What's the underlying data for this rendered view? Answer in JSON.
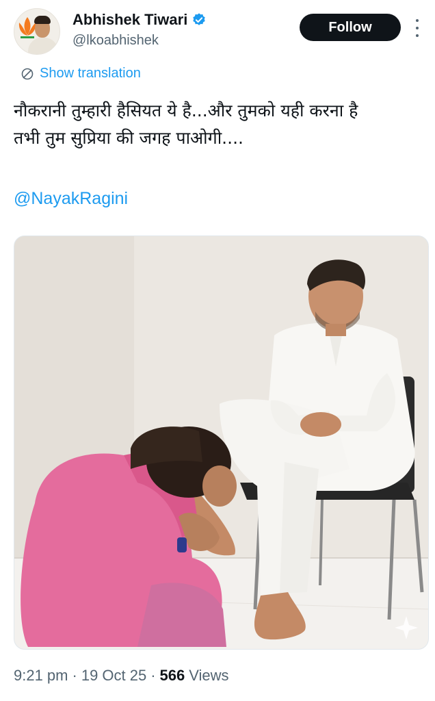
{
  "author": {
    "name": "Abhishek Tiwari",
    "handle": "@lkoabhishek",
    "verified": true,
    "verified_color": "#1d9bf0"
  },
  "actions": {
    "follow_label": "Follow",
    "more_icon": "more-vertical-icon"
  },
  "translation": {
    "label": "Show translation",
    "icon": "translate-icon"
  },
  "tweet": {
    "line1": "नौकरानी तुम्हारी हैसियत ये है...और तुमको यही करना है",
    "line2": "तभी तुम सुप्रिया की जगह पाओगी....",
    "mention": "@NayakRagini"
  },
  "media": {
    "badge_icon": "sparkle-icon"
  },
  "meta": {
    "time": "9:21 pm",
    "separator": "·",
    "date": "19 Oct 25",
    "views_count": "566",
    "views_label": "Views"
  },
  "colors": {
    "accent": "#1d9bf0",
    "text": "#0f1419",
    "muted": "#536471",
    "button_bg": "#0f1419"
  }
}
